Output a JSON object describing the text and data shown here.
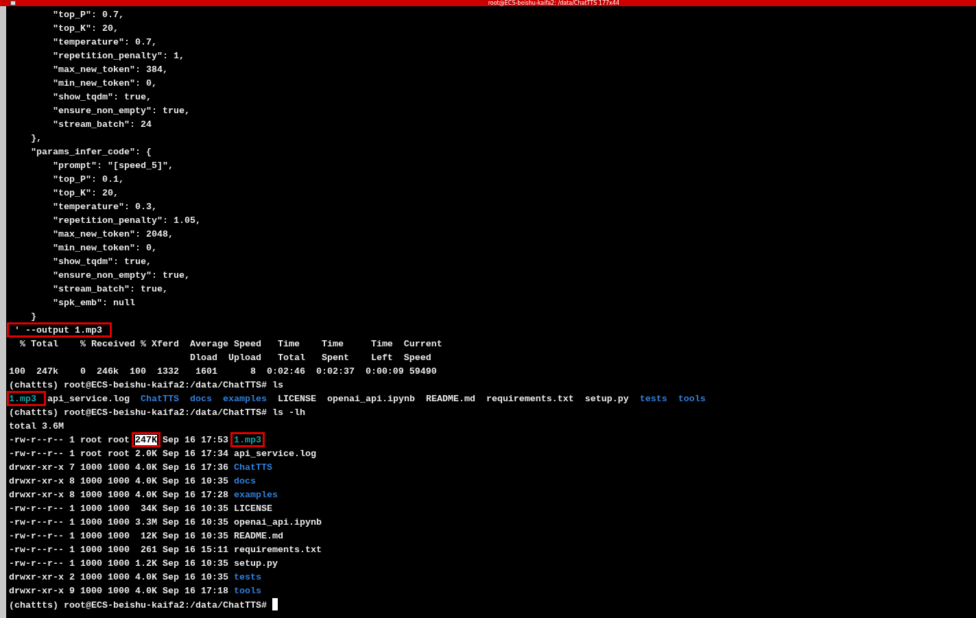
{
  "window": {
    "title": "root@ECS-beishu-kaifa2: /data/ChatTTS 177x44"
  },
  "terminal": {
    "lines": [
      {
        "text": "        \"top_P\": 0.7,"
      },
      {
        "text": "        \"top_K\": 20,"
      },
      {
        "text": "        \"temperature\": 0.7,"
      },
      {
        "text": "        \"repetition_penalty\": 1,"
      },
      {
        "text": "        \"max_new_token\": 384,"
      },
      {
        "text": "        \"min_new_token\": 0,"
      },
      {
        "text": "        \"show_tqdm\": true,"
      },
      {
        "text": "        \"ensure_non_empty\": true,"
      },
      {
        "text": "        \"stream_batch\": 24"
      },
      {
        "text": "    },"
      },
      {
        "text": "    \"params_infer_code\": {"
      },
      {
        "text": "        \"prompt\": \"[speed_5]\","
      },
      {
        "text": "        \"top_P\": 0.1,"
      },
      {
        "text": "        \"top_K\": 20,"
      },
      {
        "text": "        \"temperature\": 0.3,"
      },
      {
        "text": "        \"repetition_penalty\": 1.05,"
      },
      {
        "text": "        \"max_new_token\": 2048,"
      },
      {
        "text": "        \"min_new_token\": 0,"
      },
      {
        "text": "        \"show_tqdm\": true,"
      },
      {
        "text": "        \"ensure_non_empty\": true,"
      },
      {
        "text": "        \"stream_batch\": true,"
      },
      {
        "text": "        \"spk_emb\": null"
      },
      {
        "text": "    }"
      },
      {
        "segments": [
          {
            "text": " ' --output 1.mp3",
            "kind": "plain",
            "boxed": true
          }
        ]
      },
      {
        "text": "  % Total    % Received % Xferd  Average Speed   Time    Time     Time  Current"
      },
      {
        "text": "                                 Dload  Upload   Total   Spent    Left  Speed"
      },
      {
        "text": "100  247k    0  246k  100  1332   1601      8  0:02:46  0:02:37  0:00:09 59490"
      },
      {
        "text": "(chattts) root@ECS-beishu-kaifa2:/data/ChatTTS# ls"
      },
      {
        "segments": [
          {
            "text": "1.mp3",
            "kind": "audio",
            "boxed": true
          },
          {
            "text": "  api_service.log  ",
            "kind": "plain",
            "boxed": false
          },
          {
            "text": "ChatTTS",
            "kind": "directory",
            "boxed": false
          },
          {
            "text": "  docs",
            "kind": "directory",
            "boxed": false
          },
          {
            "text": "  examples",
            "kind": "directory",
            "boxed": false
          },
          {
            "text": "  LICENSE  openai_api.ipynb  README.md  requirements.txt  setup.py  ",
            "kind": "plain",
            "boxed": false
          },
          {
            "text": "tests",
            "kind": "directory",
            "boxed": false
          },
          {
            "text": "  tools",
            "kind": "directory",
            "boxed": false
          }
        ]
      },
      {
        "text": "(chattts) root@ECS-beishu-kaifa2:/data/ChatTTS# ls -lh"
      },
      {
        "text": "total 3.6M"
      },
      {
        "segments": [
          {
            "text": "-rw-r--r-- 1 root root ",
            "kind": "plain",
            "boxed": false
          },
          {
            "text": "247K",
            "kind": "selected",
            "boxed": true
          },
          {
            "text": " Sep 16 17:53 ",
            "kind": "plain",
            "boxed": false
          },
          {
            "text": "1.mp3",
            "kind": "audio",
            "boxed": true
          }
        ]
      },
      {
        "text": "-rw-r--r-- 1 root root 2.0K Sep 16 17:34 api_service.log"
      },
      {
        "segments": [
          {
            "text": "drwxr-xr-x 7 1000 1000 4.0K Sep 16 17:36 ",
            "kind": "plain",
            "boxed": false
          },
          {
            "text": "ChatTTS",
            "kind": "directory",
            "boxed": false
          }
        ]
      },
      {
        "segments": [
          {
            "text": "drwxr-xr-x 8 1000 1000 4.0K Sep 16 10:35 ",
            "kind": "plain",
            "boxed": false
          },
          {
            "text": "docs",
            "kind": "directory",
            "boxed": false
          }
        ]
      },
      {
        "segments": [
          {
            "text": "drwxr-xr-x 8 1000 1000 4.0K Sep 16 17:28 ",
            "kind": "plain",
            "boxed": false
          },
          {
            "text": "examples",
            "kind": "directory",
            "boxed": false
          }
        ]
      },
      {
        "text": "-rw-r--r-- 1 1000 1000  34K Sep 16 10:35 LICENSE"
      },
      {
        "text": "-rw-r--r-- 1 1000 1000 3.3M Sep 16 10:35 openai_api.ipynb"
      },
      {
        "text": "-rw-r--r-- 1 1000 1000  12K Sep 16 10:35 README.md"
      },
      {
        "text": "-rw-r--r-- 1 1000 1000  261 Sep 16 15:11 requirements.txt"
      },
      {
        "text": "-rw-r--r-- 1 1000 1000 1.2K Sep 16 10:35 setup.py"
      },
      {
        "segments": [
          {
            "text": "drwxr-xr-x 2 1000 1000 4.0K Sep 16 10:35 ",
            "kind": "plain",
            "boxed": false
          },
          {
            "text": "tests",
            "kind": "directory",
            "boxed": false
          }
        ]
      },
      {
        "segments": [
          {
            "text": "drwxr-xr-x 9 1000 1000 4.0K Sep 16 17:18 ",
            "kind": "plain",
            "boxed": false
          },
          {
            "text": "tools",
            "kind": "directory",
            "boxed": false
          }
        ]
      },
      {
        "text": "(chattts) root@ECS-beishu-kaifa2:/data/ChatTTS# ",
        "cursor": true
      }
    ]
  }
}
